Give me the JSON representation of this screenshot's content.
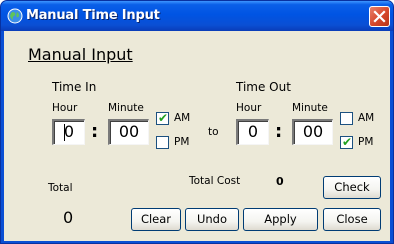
{
  "window": {
    "title": "Manual Time Input"
  },
  "form": {
    "heading": "Manual Input",
    "time_in": {
      "label": "Time In",
      "hour_label": "Hour",
      "minute_label": "Minute",
      "hour_value": "0",
      "minute_value": "00",
      "am_label": "AM",
      "pm_label": "PM",
      "am_checked": true,
      "pm_checked": false
    },
    "separator": ":",
    "to_label": "to",
    "time_out": {
      "label": "Time Out",
      "hour_label": "Hour",
      "minute_label": "Minute",
      "hour_value": "0",
      "minute_value": "00",
      "am_label": "AM",
      "pm_label": "PM",
      "am_checked": false,
      "pm_checked": true
    },
    "total_label": "Total",
    "total_value": "0",
    "total_cost_label": "Total Cost",
    "total_cost_value": "0"
  },
  "buttons": {
    "check": "Check",
    "clear": "Clear",
    "undo": "Undo",
    "apply": "Apply",
    "close": "Close"
  },
  "icons": {
    "title": "globe-icon",
    "close": "close-icon",
    "checkmark": "✔"
  },
  "colors": {
    "titlebar": "#0054e3",
    "client_bg": "#ece9d8",
    "close_button": "#d6472a",
    "checkmark": "#21a121"
  }
}
